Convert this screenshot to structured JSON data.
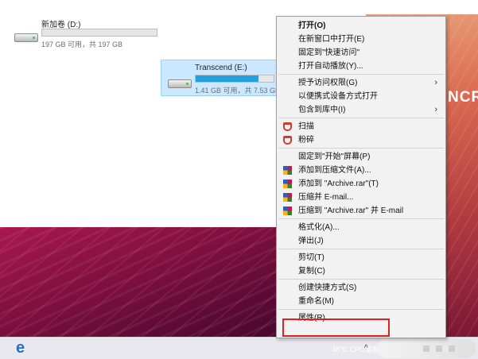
{
  "explorer": {
    "drives": [
      {
        "name": "新加卷 (D:)",
        "info": "197 GB 可用，共 197 GB",
        "usage_fraction": 0.0,
        "selected": false
      },
      {
        "name": "Transcend (E:)",
        "info": "1.41 GB 可用，共 7.53 GB",
        "usage_fraction": 0.81,
        "selected": true
      }
    ]
  },
  "wallpaper": {
    "brand_text": "NCR"
  },
  "context_menu": {
    "items": [
      {
        "label": "打开(O)",
        "bold": true
      },
      {
        "label": "在新窗口中打开(E)"
      },
      {
        "label": "固定到\"快速访问\""
      },
      {
        "label": "打开自动播放(Y)..."
      },
      {
        "separator": true
      },
      {
        "label": "授予访问权限(G)",
        "submenu": true
      },
      {
        "label": "以便携式设备方式打开"
      },
      {
        "label": "包含到库中(I)",
        "submenu": true
      },
      {
        "separator": true
      },
      {
        "label": "扫描",
        "icon": "shield-icon"
      },
      {
        "label": "粉碎",
        "icon": "shield-icon"
      },
      {
        "separator": true
      },
      {
        "label": "固定到\"开始\"屏幕(P)"
      },
      {
        "label": "添加到压缩文件(A)...",
        "icon": "winrar-icon"
      },
      {
        "label": "添加到 \"Archive.rar\"(T)",
        "icon": "winrar-icon"
      },
      {
        "label": "压缩并 E-mail...",
        "icon": "winrar-icon"
      },
      {
        "label": "压缩到 \"Archive.rar\" 并 E-mail",
        "icon": "winrar-icon"
      },
      {
        "separator": true
      },
      {
        "label": "格式化(A)..."
      },
      {
        "label": "弹出(J)"
      },
      {
        "separator": true
      },
      {
        "label": "剪切(T)"
      },
      {
        "label": "复制(C)"
      },
      {
        "separator": true
      },
      {
        "label": "创建快捷方式(S)"
      },
      {
        "label": "重命名(M)"
      },
      {
        "separator": true
      },
      {
        "label": "属性(R)",
        "highlighted": true
      }
    ]
  },
  "taskbar": {
    "edge_glyph": "e",
    "weather": "48℃ CPU温度",
    "tray_chevron": "^"
  },
  "colors": {
    "highlight": "#e02020",
    "selection": "#cce8ff",
    "accent": "#26a0da"
  }
}
